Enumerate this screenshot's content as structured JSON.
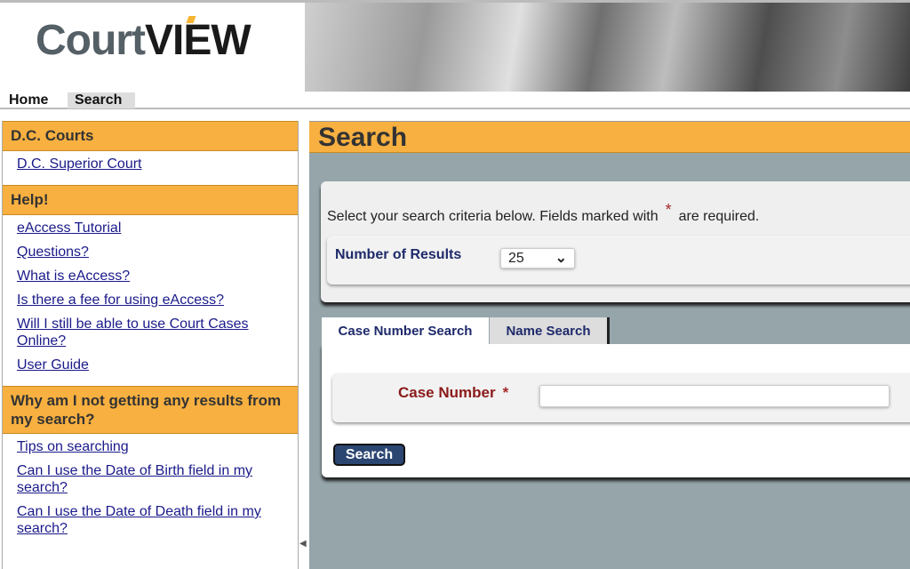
{
  "header": {
    "logo_text_light": "Court",
    "logo_text_dark": "VIEW",
    "logo_accent_color": "#f5b431"
  },
  "nav": {
    "items": [
      {
        "label": "Home"
      },
      {
        "label": "Search"
      }
    ]
  },
  "sidebar": {
    "sections": [
      {
        "title": "D.C. Courts",
        "links": [
          "D.C. Superior Court"
        ]
      },
      {
        "title": "Help!",
        "links": [
          "eAccess Tutorial",
          "Questions?",
          "What is eAccess?",
          "Is there a fee for using eAccess?",
          "Will I still be able to use Court Cases Online?",
          "User Guide"
        ]
      },
      {
        "title": "Why am I not getting any results from my search?",
        "links": [
          "Tips on searching",
          "Can I use the Date of Birth field in my search?",
          "Can I use the Date of Death field in my search?"
        ]
      }
    ]
  },
  "main": {
    "title": "Search",
    "instructions_pre": "Select your search criteria below. Fields marked with",
    "required_mark": "*",
    "instructions_post": "are required.",
    "results_label": "Number of Results",
    "results_value": "25",
    "tabs": [
      {
        "label": "Case Number Search",
        "active": true
      },
      {
        "label": "Name Search",
        "active": false
      }
    ],
    "case_number_label": "Case Number",
    "case_number_value": "",
    "search_button": "Search"
  },
  "colors": {
    "accent": "#f8b040",
    "background": "#95a5aa",
    "button": "#2c4672",
    "required": "#a52a2a"
  }
}
